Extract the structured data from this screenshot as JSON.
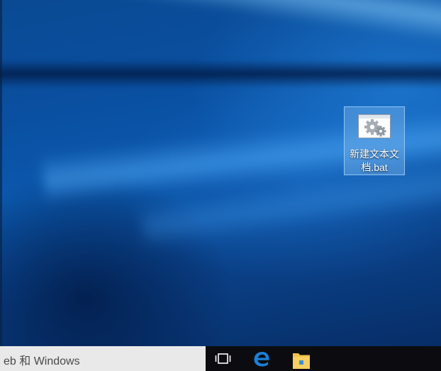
{
  "desktop": {
    "icons": [
      {
        "label": "新建文本文档.bat",
        "icon": "batch-file-gears-icon"
      }
    ]
  },
  "taskbar": {
    "search_text": "eb 和 Windows",
    "buttons": [
      {
        "name": "task-view-button",
        "icon": "task-view-icon"
      },
      {
        "name": "edge-button",
        "icon": "edge-icon"
      },
      {
        "name": "explorer-button",
        "icon": "folder-icon"
      }
    ]
  },
  "colors": {
    "wallpaper": "#0a4fa0",
    "taskbar": "#0c0c10",
    "search_box": "#e9e9e9",
    "selection": "#78b4eb",
    "edge": "#1a7fd8",
    "folder": "#f3c24a"
  }
}
